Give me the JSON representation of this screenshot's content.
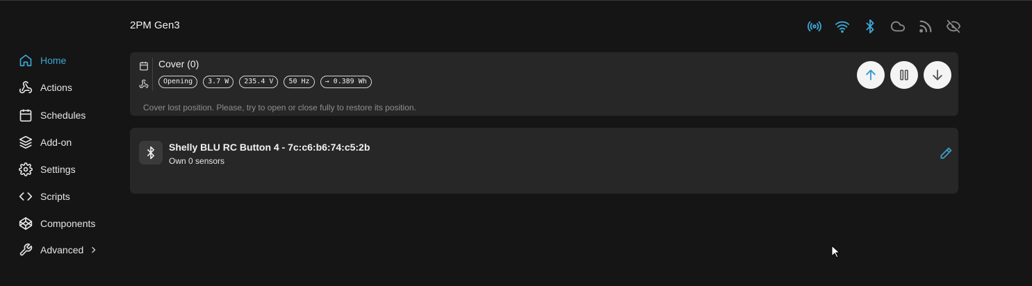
{
  "header": {
    "device_title": "2PM Gen3"
  },
  "status_icons": [
    {
      "icon": "broadcast-icon",
      "color": "#3ea6d6"
    },
    {
      "icon": "wifi-icon",
      "color": "#3ea6d6"
    },
    {
      "icon": "bluetooth-icon",
      "color": "#3ea6d6"
    },
    {
      "icon": "cloud-icon",
      "color": "#8a8a8a"
    },
    {
      "icon": "rss-icon",
      "color": "#8a8a8a"
    },
    {
      "icon": "eye-off-icon",
      "color": "#8a8a8a"
    }
  ],
  "sidebar": {
    "items": [
      {
        "label": "Home",
        "icon": "home-icon",
        "active": true
      },
      {
        "label": "Actions",
        "icon": "webhook-icon"
      },
      {
        "label": "Schedules",
        "icon": "calendar-icon"
      },
      {
        "label": "Add-on",
        "icon": "layers-icon"
      },
      {
        "label": "Settings",
        "icon": "gear-icon"
      },
      {
        "label": "Scripts",
        "icon": "code-icon"
      },
      {
        "label": "Components",
        "icon": "codepen-icon"
      },
      {
        "label": "Advanced",
        "icon": "wrench-icon",
        "has_submenu": true
      }
    ]
  },
  "cover": {
    "title": "Cover (0)",
    "badges": [
      "Opening",
      "3.7 W",
      "235.4 V",
      "50 Hz",
      "→ 0.389 Wh"
    ],
    "message": "Cover lost position. Please, try to open or close fully to restore its position.",
    "controls": [
      "open",
      "stop",
      "close"
    ]
  },
  "ble_device": {
    "name": "Shelly BLU RC Button 4 - 7c:c6:b6:74:c5:2b",
    "subtitle": "Own 0 sensors"
  },
  "colors": {
    "accent": "#3ea6d6",
    "background": "#151515",
    "card": "#272727"
  }
}
